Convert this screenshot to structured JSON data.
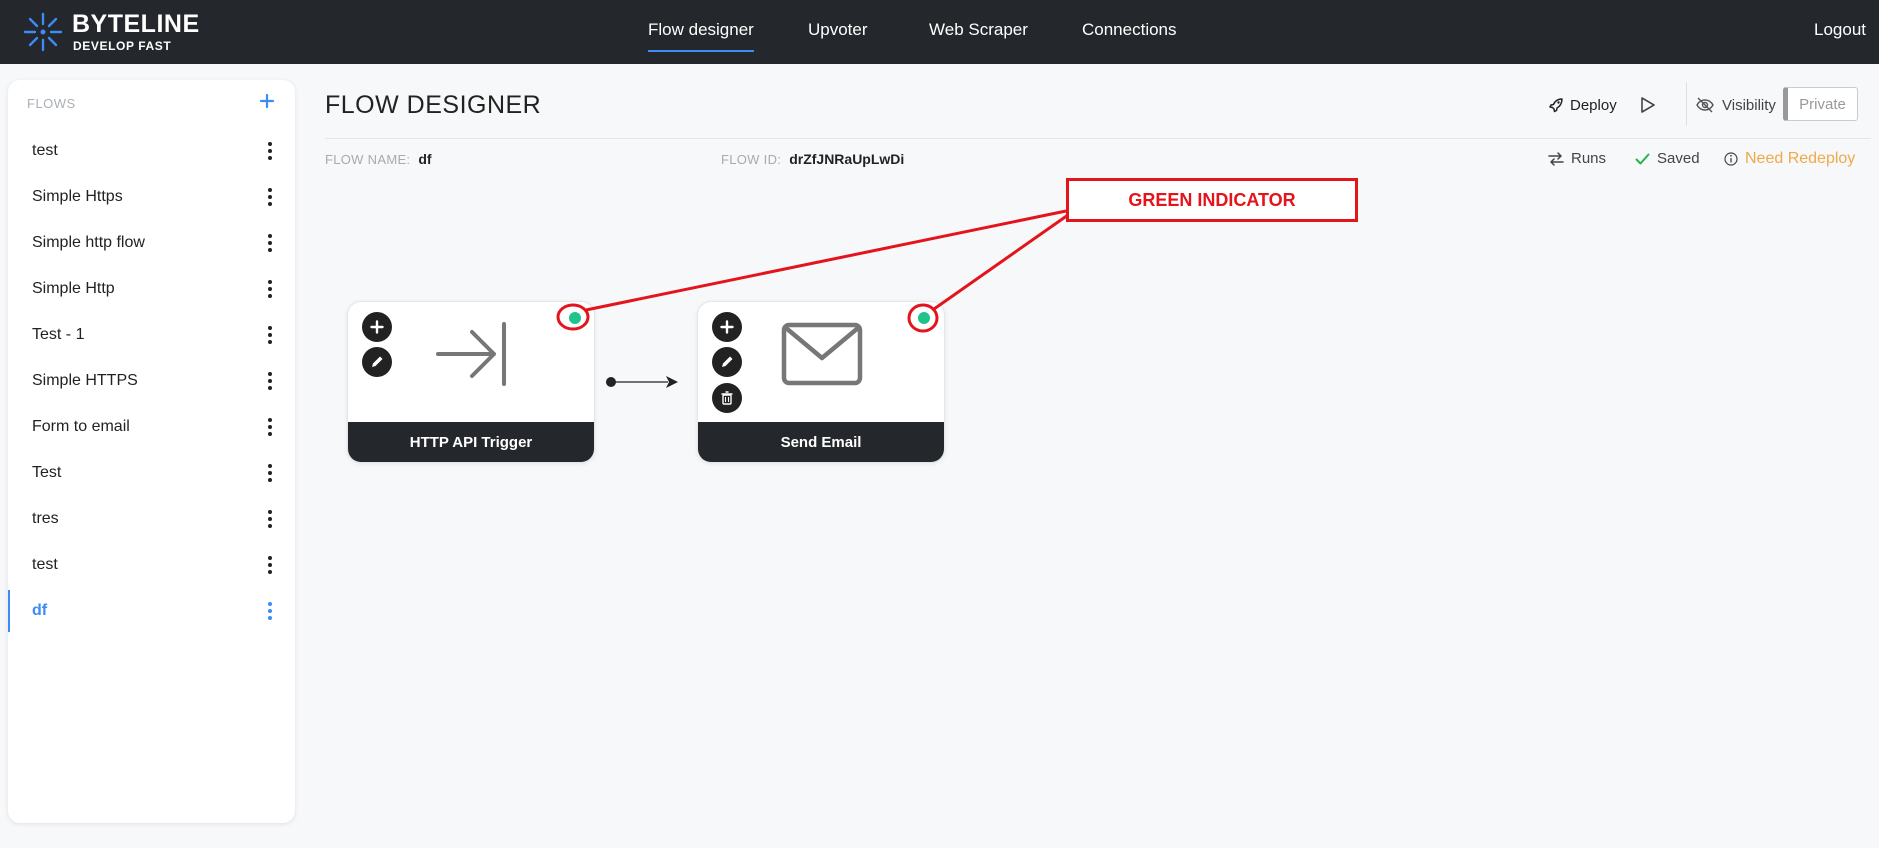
{
  "brand": {
    "name": "BYTELINE",
    "tagline": "DEVELOP FAST",
    "accent": "#3d8bf7"
  },
  "nav": {
    "items": [
      {
        "label": "Flow designer",
        "active": true
      },
      {
        "label": "Upvoter"
      },
      {
        "label": "Web Scraper"
      },
      {
        "label": "Connections"
      }
    ],
    "logout": "Logout"
  },
  "sidebar": {
    "header": "FLOWS",
    "add_icon": "plus-icon",
    "flows": [
      {
        "label": "test"
      },
      {
        "label": "Simple Https"
      },
      {
        "label": "Simple http flow"
      },
      {
        "label": "Simple Http"
      },
      {
        "label": "Test - 1"
      },
      {
        "label": "Simple HTTPS"
      },
      {
        "label": "Form to email"
      },
      {
        "label": "Test"
      },
      {
        "label": "tres"
      },
      {
        "label": "test"
      },
      {
        "label": "df",
        "active": true
      }
    ]
  },
  "page": {
    "title": "FLOW DESIGNER",
    "deploy_label": "Deploy",
    "visibility_label": "Visibility",
    "private_label": "Private",
    "flow_name_key": "FLOW NAME:",
    "flow_name": "df",
    "flow_id_key": "FLOW ID:",
    "flow_id": "drZfJNRaUpLwDi",
    "runs_label": "Runs",
    "saved_label": "Saved",
    "redeploy_label": "Need Redeploy",
    "redeploy_color": "#f0a94a",
    "saved_color": "#2bb24c"
  },
  "canvas": {
    "nodes": [
      {
        "title": "HTTP API Trigger",
        "icon": "arrow-to-line-icon",
        "status": "green"
      },
      {
        "title": "Send Email",
        "icon": "envelope-icon",
        "status": "green"
      }
    ],
    "indicator_color": "#1ec48c"
  },
  "annotation": {
    "label": "GREEN INDICATOR",
    "color": "#e3141b"
  }
}
